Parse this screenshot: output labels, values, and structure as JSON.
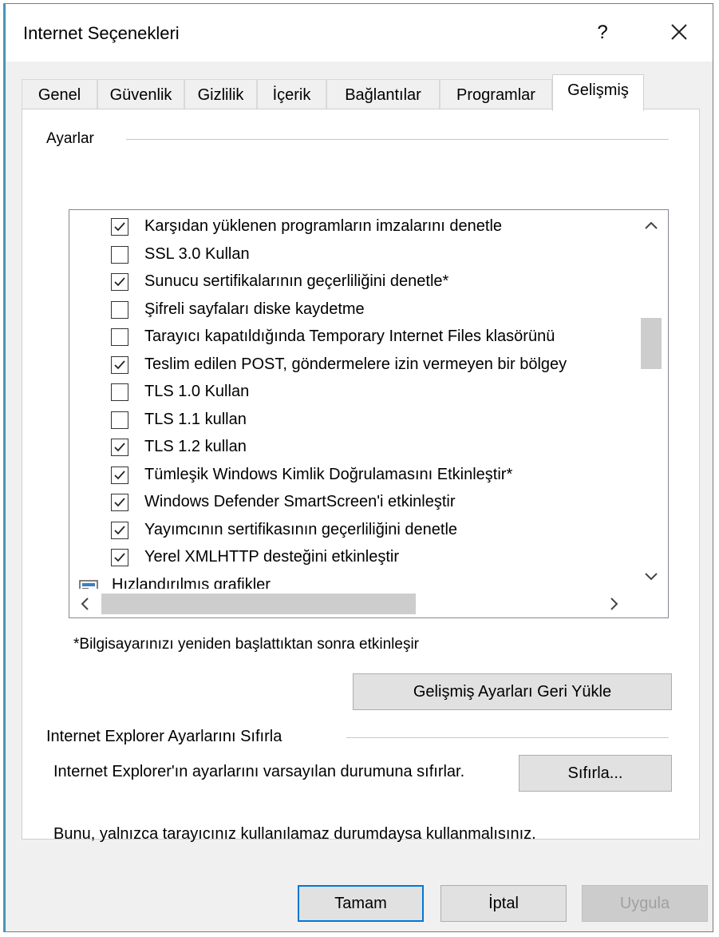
{
  "window": {
    "title": "Internet Seçenekleri",
    "help_label": "?"
  },
  "tabs": [
    {
      "label": "Genel"
    },
    {
      "label": "Güvenlik"
    },
    {
      "label": "Gizlilik"
    },
    {
      "label": "İçerik"
    },
    {
      "label": "Bağlantılar"
    },
    {
      "label": "Programlar"
    },
    {
      "label": "Gelişmiş",
      "active": true
    }
  ],
  "settings": {
    "group_label": "Ayarlar",
    "items": [
      {
        "label": "Karşıdan yüklenen programların imzalarını denetle",
        "checked": true
      },
      {
        "label": "SSL 3.0 Kullan",
        "checked": false
      },
      {
        "label": "Sunucu sertifikalarının geçerliliğini denetle*",
        "checked": true
      },
      {
        "label": "Şifreli sayfaları diske kaydetme",
        "checked": false
      },
      {
        "label": "Tarayıcı kapatıldığında Temporary Internet  Files klasörünü",
        "checked": false
      },
      {
        "label": "Teslim edilen POST, göndermelere izin vermeyen bir bölgey",
        "checked": true
      },
      {
        "label": "TLS 1.0 Kullan",
        "checked": false
      },
      {
        "label": "TLS 1.1 kullan",
        "checked": false
      },
      {
        "label": "TLS 1.2 kullan",
        "checked": true
      },
      {
        "label": "Tümleşik Windows Kimlik Doğrulamasını Etkinleştir*",
        "checked": true
      },
      {
        "label": "Windows Defender SmartScreen'i etkinleştir",
        "checked": true
      },
      {
        "label": "Yayımcının sertifikasının geçerliliğini denetle",
        "checked": true
      },
      {
        "label": "Yerel XMLHTTP desteğini etkinleştir",
        "checked": true
      }
    ],
    "category": {
      "label": "Hızlandırılmış grafikler",
      "icon": "display-icon"
    },
    "restart_note": "*Bilgisayarınızı yeniden başlattıktan sonra etkinleşir",
    "restore_button": "Gelişmiş Ayarları Geri Yükle"
  },
  "reset": {
    "group_label": "Internet Explorer Ayarlarını Sıfırla",
    "description": "Internet Explorer'ın ayarlarını varsayılan durumuna sıfırlar.",
    "button": "Sıfırla...",
    "warning": "Bunu, yalnızca tarayıcınız kullanılamaz durumdaysa kullanmalısınız."
  },
  "footer": {
    "ok_label": "Tamam",
    "cancel_label": "İptal",
    "apply_label": "Uygula",
    "apply_enabled": false
  },
  "colors": {
    "dialog_bg": "#f0f0f0",
    "panel_bg": "#ffffff",
    "button_bg": "#e1e1e1",
    "default_button_border": "#0078d7",
    "disabled_text": "#a0a0a0",
    "scroll_thumb": "#cdcdcd"
  }
}
